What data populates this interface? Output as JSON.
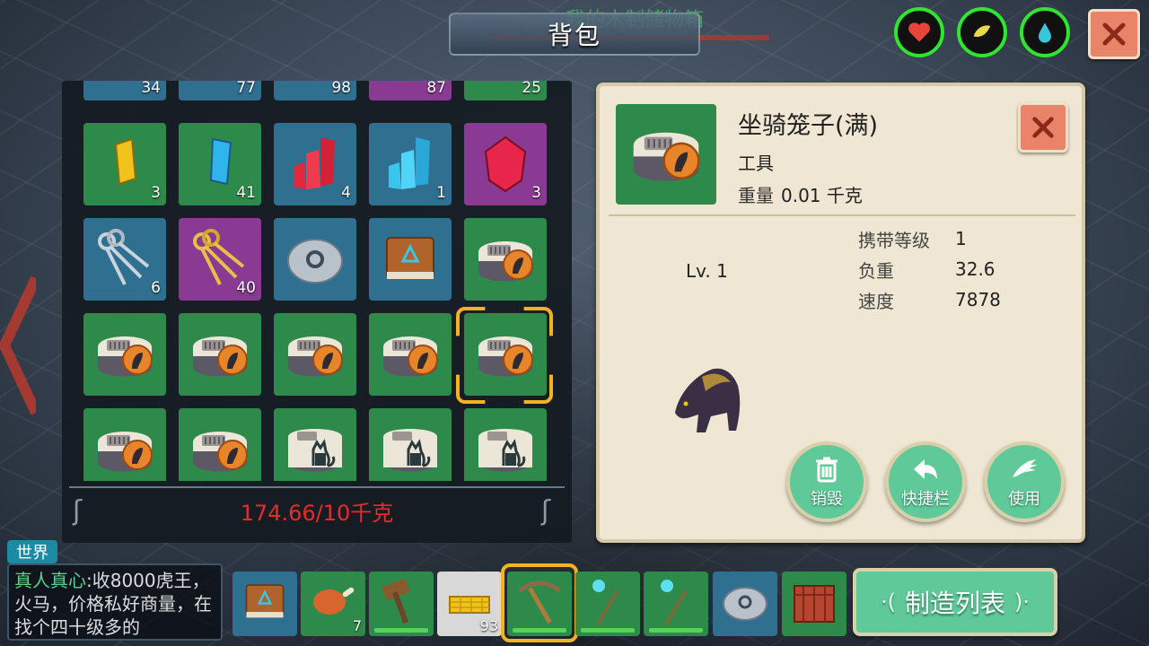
{
  "header": {
    "title": "背包",
    "chest_label": "我的木制储物箱"
  },
  "status": {
    "health_icon": "heart-icon",
    "hunger_icon": "food-icon",
    "thirst_icon": "water-drop-icon",
    "ring_color": "#2fe62f"
  },
  "inventory": {
    "top_row_counts": [
      "34",
      "77",
      "98",
      "87",
      "25"
    ],
    "rows": [
      [
        {
          "item": "yellow-crystal",
          "count": "3"
        },
        {
          "item": "blue-crystal",
          "count": "41"
        },
        {
          "item": "red-crystal-cluster",
          "count": "4"
        },
        {
          "item": "blue-crystal-cluster",
          "count": "1"
        },
        {
          "item": "red-gem",
          "count": "3"
        }
      ],
      [
        {
          "item": "silver-keys",
          "count": "6"
        },
        {
          "item": "gold-keys",
          "count": "40"
        },
        {
          "item": "stone-disc",
          "count": ""
        },
        {
          "item": "book",
          "count": ""
        },
        {
          "item": "mount-cage",
          "count": ""
        }
      ],
      [
        {
          "item": "mount-cage",
          "count": ""
        },
        {
          "item": "mount-cage",
          "count": ""
        },
        {
          "item": "mount-cage",
          "count": ""
        },
        {
          "item": "mount-cage",
          "count": ""
        },
        {
          "item": "mount-cage",
          "count": ""
        }
      ],
      [
        {
          "item": "mount-cage",
          "count": ""
        },
        {
          "item": "mount-cage",
          "count": ""
        },
        {
          "item": "cat-cage",
          "count": ""
        },
        {
          "item": "cat-cage",
          "count": ""
        },
        {
          "item": "cat-cage",
          "count": ""
        }
      ]
    ],
    "weight": "174.66/10千克"
  },
  "detail": {
    "name": "坐骑笼子(满)",
    "category": "工具",
    "weight_label": "重量",
    "weight_value": "0.01 千克",
    "level": "Lv. 1",
    "stats": [
      {
        "key": "携带等级",
        "value": "1"
      },
      {
        "key": "负重",
        "value": "32.6"
      },
      {
        "key": "速度",
        "value": "7878"
      }
    ],
    "actions": {
      "destroy": "销毁",
      "hotbar": "快捷栏",
      "use": "使用"
    }
  },
  "chat": {
    "channel": "世界",
    "sender": "真人真心",
    "message": ":收8000虎王，火马，价格私好商量，在找个四十级多的"
  },
  "hotbar": {
    "slots": [
      {
        "item": "book",
        "count": ""
      },
      {
        "item": "meat",
        "count": "7"
      },
      {
        "item": "wooden-hammer",
        "count": ""
      },
      {
        "item": "gold-bricks",
        "count": "93"
      },
      {
        "item": "pickaxe",
        "count": ""
      },
      {
        "item": "magic-staff",
        "count": ""
      },
      {
        "item": "magic-staff",
        "count": ""
      },
      {
        "item": "stone-disc",
        "count": ""
      },
      {
        "item": "wooden-crate",
        "count": ""
      }
    ],
    "craft_label": "制造列表"
  }
}
